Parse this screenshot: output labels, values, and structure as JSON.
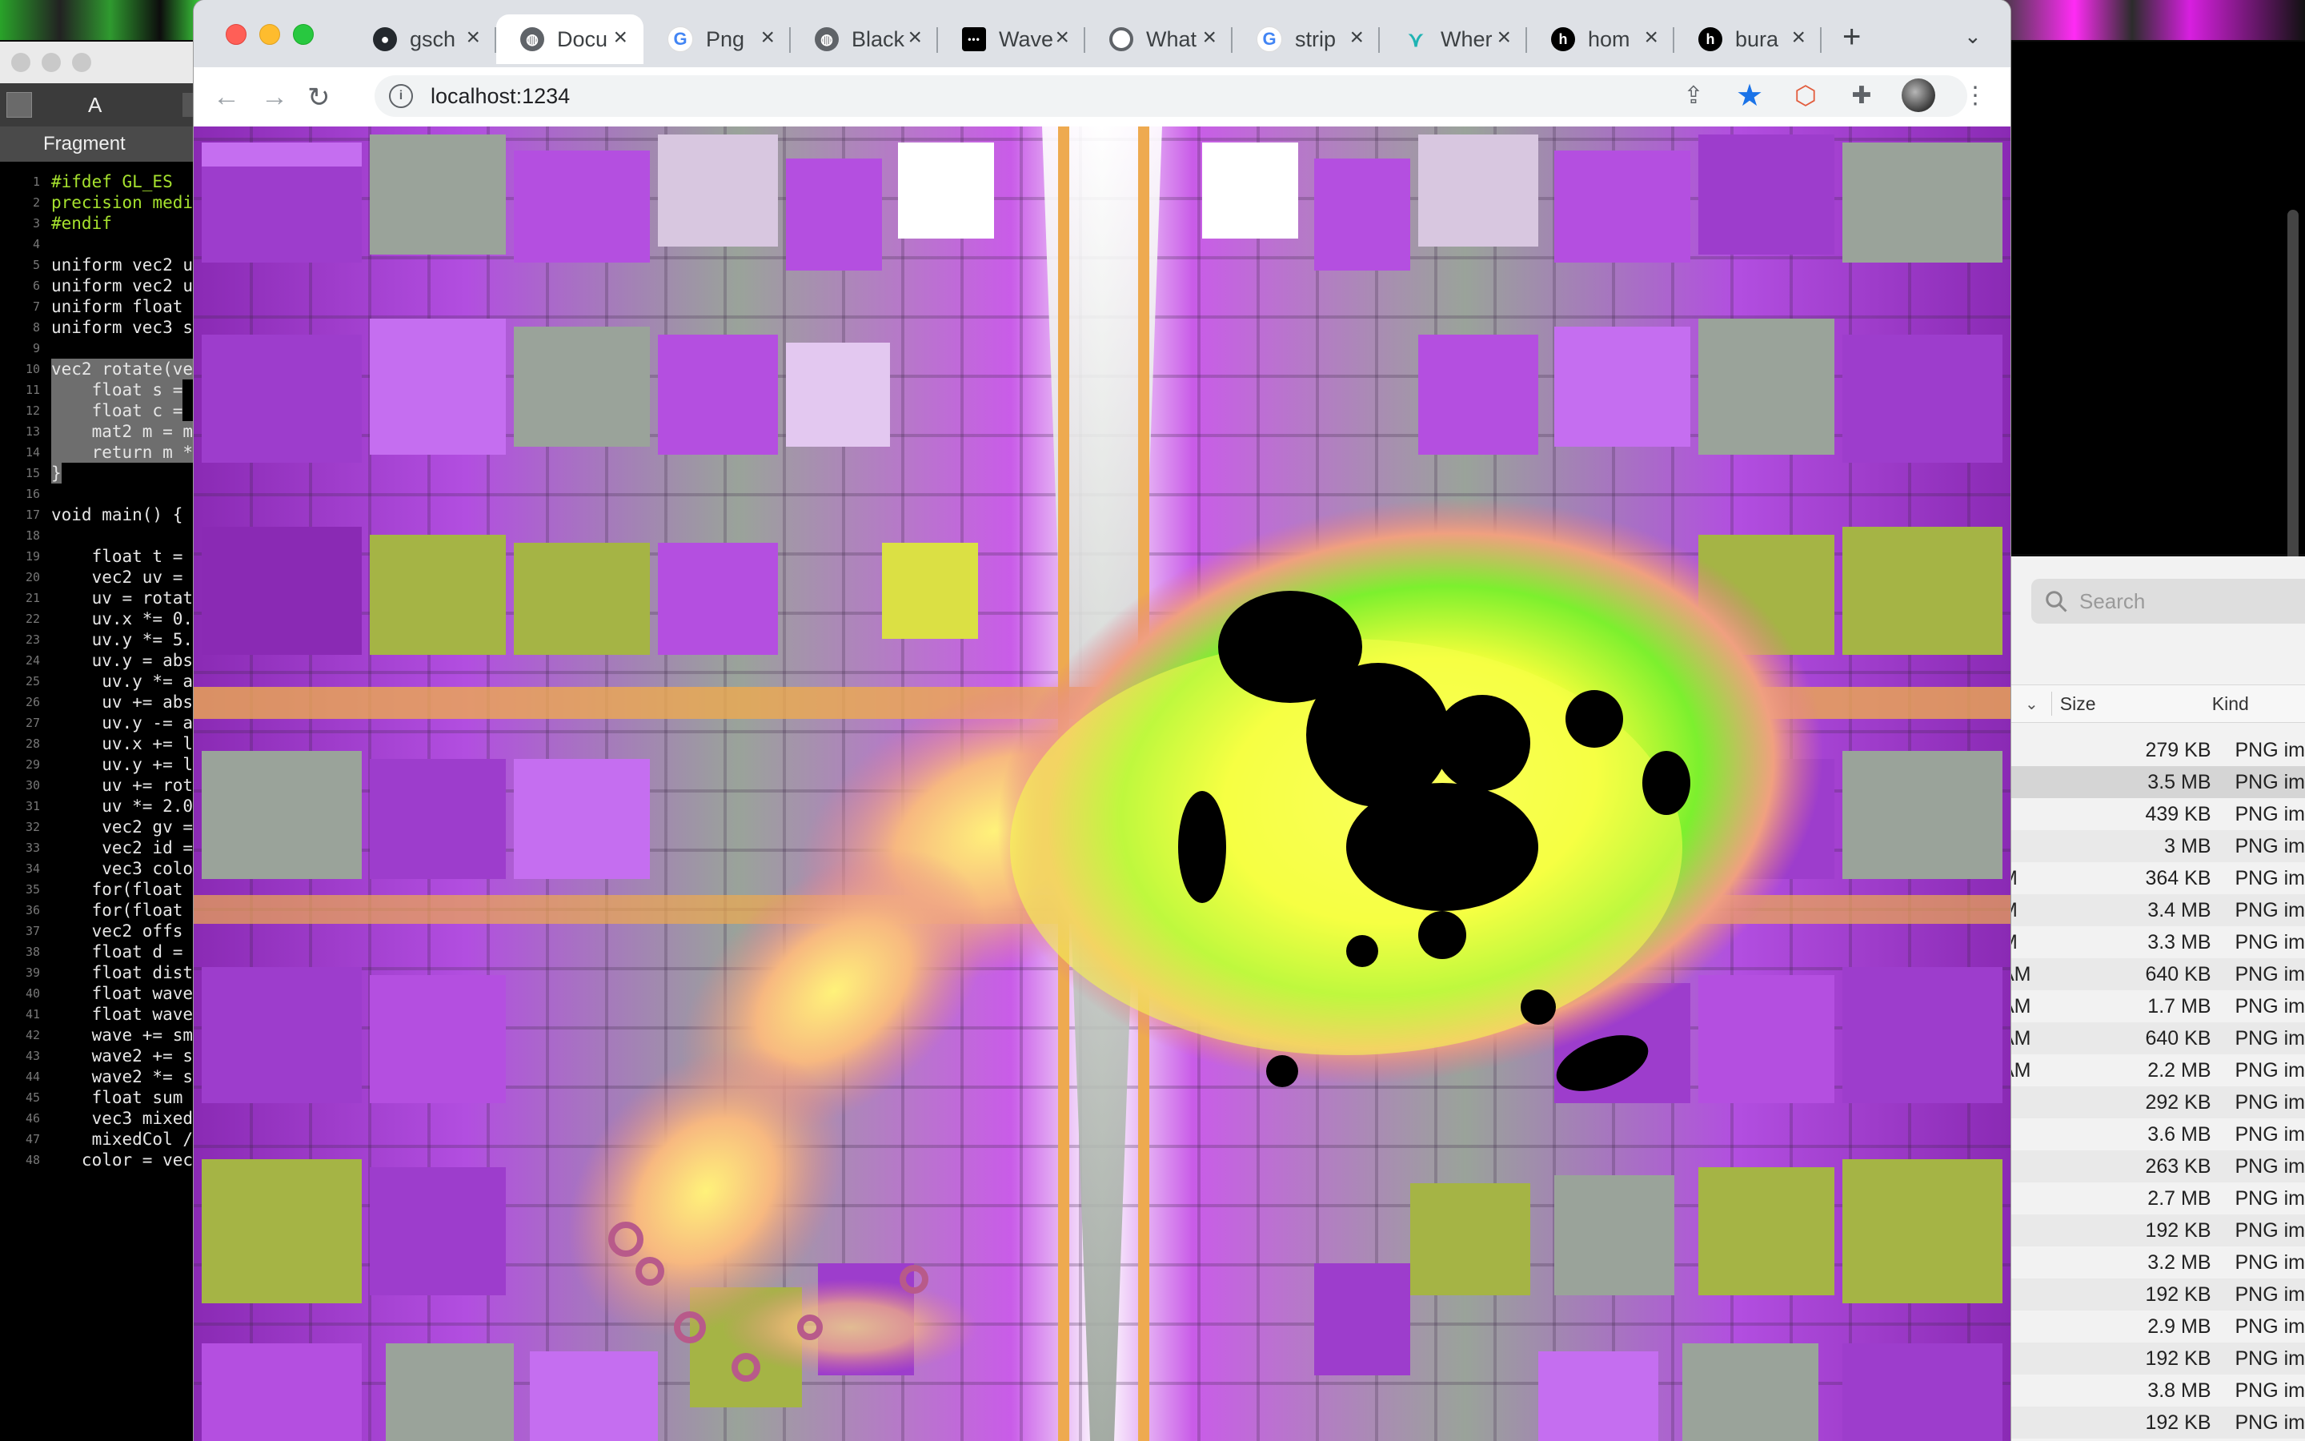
{
  "editor": {
    "toolbar_label": "A",
    "tab_label": "Fragment",
    "lines": [
      {
        "n": "1",
        "text": "#ifdef GL_ES",
        "kind": "pre"
      },
      {
        "n": "2",
        "text": "precision medi",
        "kind": "pre"
      },
      {
        "n": "3",
        "text": "#endif",
        "kind": "pre"
      },
      {
        "n": "4",
        "text": "",
        "kind": "code"
      },
      {
        "n": "5",
        "text": "uniform vec2 u",
        "kind": "code"
      },
      {
        "n": "6",
        "text": "uniform vec2 u",
        "kind": "code"
      },
      {
        "n": "7",
        "text": "uniform float",
        "kind": "code"
      },
      {
        "n": "8",
        "text": "uniform vec3 s",
        "kind": "code"
      },
      {
        "n": "9",
        "text": "",
        "kind": "code"
      },
      {
        "n": "10",
        "text": "vec2 rotate(ve",
        "kind": "sel"
      },
      {
        "n": "11",
        "text": "    float s =",
        "kind": "sel"
      },
      {
        "n": "12",
        "text": "    float c =",
        "kind": "sel"
      },
      {
        "n": "13",
        "text": "    mat2 m = m",
        "kind": "sel"
      },
      {
        "n": "14",
        "text": "    return m *",
        "kind": "sel"
      },
      {
        "n": "15",
        "text": "}",
        "kind": "sel"
      },
      {
        "n": "16",
        "text": "",
        "kind": "code"
      },
      {
        "n": "17",
        "text": "void main() {",
        "kind": "code"
      },
      {
        "n": "18",
        "text": "",
        "kind": "code"
      },
      {
        "n": "19",
        "text": "    float t =",
        "kind": "code"
      },
      {
        "n": "20",
        "text": "    vec2 uv =",
        "kind": "code"
      },
      {
        "n": "21",
        "text": "    uv = rotat",
        "kind": "code"
      },
      {
        "n": "22",
        "text": "    uv.x *= 0.",
        "kind": "code"
      },
      {
        "n": "23",
        "text": "    uv.y *= 5.",
        "kind": "code"
      },
      {
        "n": "24",
        "text": "    uv.y = abs",
        "kind": "code"
      },
      {
        "n": "25",
        "text": "     uv.y *= a",
        "kind": "code"
      },
      {
        "n": "26",
        "text": "     uv += abs",
        "kind": "code"
      },
      {
        "n": "27",
        "text": "     uv.y -= a",
        "kind": "code"
      },
      {
        "n": "28",
        "text": "     uv.x += l",
        "kind": "code"
      },
      {
        "n": "29",
        "text": "     uv.y += l",
        "kind": "code"
      },
      {
        "n": "30",
        "text": "     uv += rot",
        "kind": "code"
      },
      {
        "n": "31",
        "text": "     uv *= 2.0",
        "kind": "code"
      },
      {
        "n": "32",
        "text": "     vec2 gv =",
        "kind": "code"
      },
      {
        "n": "33",
        "text": "     vec2 id =",
        "kind": "code"
      },
      {
        "n": "34",
        "text": "     vec3 colo",
        "kind": "code"
      },
      {
        "n": "35",
        "text": "    for(float",
        "kind": "code"
      },
      {
        "n": "36",
        "text": "    for(float",
        "kind": "code"
      },
      {
        "n": "37",
        "text": "    vec2 offs",
        "kind": "code"
      },
      {
        "n": "38",
        "text": "    float d =",
        "kind": "code"
      },
      {
        "n": "39",
        "text": "    float dist",
        "kind": "code"
      },
      {
        "n": "40",
        "text": "    float wave",
        "kind": "code"
      },
      {
        "n": "41",
        "text": "    float wave",
        "kind": "code"
      },
      {
        "n": "42",
        "text": "    wave += sm",
        "kind": "code"
      },
      {
        "n": "43",
        "text": "    wave2 += s",
        "kind": "code"
      },
      {
        "n": "44",
        "text": "    wave2 *= s",
        "kind": "code"
      },
      {
        "n": "45",
        "text": "    float sum",
        "kind": "code"
      },
      {
        "n": "46",
        "text": "    vec3 mixed",
        "kind": "code"
      },
      {
        "n": "47",
        "text": "    mixedCol /",
        "kind": "code"
      },
      {
        "n": "48",
        "text": "   color = vec",
        "kind": "code"
      }
    ]
  },
  "browser": {
    "tabs": [
      {
        "title": "gsch",
        "favicon": "github-icon",
        "active": false
      },
      {
        "title": "Docu",
        "favicon": "globe-icon",
        "active": true
      },
      {
        "title": "Png",
        "favicon": "google-icon",
        "active": false
      },
      {
        "title": "Black",
        "favicon": "globe-icon",
        "active": false
      },
      {
        "title": "Wave",
        "favicon": "dots-icon",
        "active": false
      },
      {
        "title": "What",
        "favicon": "chromium-icon",
        "active": false
      },
      {
        "title": "strip",
        "favicon": "google-icon",
        "active": false
      },
      {
        "title": "Wher",
        "favicon": "bird-icon",
        "active": false
      },
      {
        "title": "hom",
        "favicon": "h-icon",
        "active": false
      },
      {
        "title": "bura",
        "favicon": "h-icon",
        "active": false
      }
    ],
    "url": "localhost:1234"
  },
  "finder": {
    "search_placeholder": "Search",
    "col_size": "Size",
    "col_kind": "Kind",
    "rows": [
      {
        "date": "",
        "size": "279 KB",
        "kind": "PNG im"
      },
      {
        "date": "",
        "size": "3.5 MB",
        "kind": "PNG im"
      },
      {
        "date": "",
        "size": "439 KB",
        "kind": "PNG im"
      },
      {
        "date": "",
        "size": "3 MB",
        "kind": "PNG im"
      },
      {
        "date": "M",
        "size": "364 KB",
        "kind": "PNG im"
      },
      {
        "date": "M",
        "size": "3.4 MB",
        "kind": "PNG im"
      },
      {
        "date": "M",
        "size": "3.3 MB",
        "kind": "PNG im"
      },
      {
        "date": "AM",
        "size": "640 KB",
        "kind": "PNG im"
      },
      {
        "date": "AM",
        "size": "1.7 MB",
        "kind": "PNG im"
      },
      {
        "date": "AM",
        "size": "640 KB",
        "kind": "PNG im"
      },
      {
        "date": "AM",
        "size": "2.2 MB",
        "kind": "PNG im"
      },
      {
        "date": "",
        "size": "292 KB",
        "kind": "PNG im"
      },
      {
        "date": "",
        "size": "3.6 MB",
        "kind": "PNG im"
      },
      {
        "date": "",
        "size": "263 KB",
        "kind": "PNG im"
      },
      {
        "date": "",
        "size": "2.7 MB",
        "kind": "PNG im"
      },
      {
        "date": "",
        "size": "192 KB",
        "kind": "PNG im"
      },
      {
        "date": "",
        "size": "3.2 MB",
        "kind": "PNG im"
      },
      {
        "date": "",
        "size": "192 KB",
        "kind": "PNG im"
      },
      {
        "date": "",
        "size": "2.9 MB",
        "kind": "PNG im"
      },
      {
        "date": "",
        "size": "192 KB",
        "kind": "PNG im"
      },
      {
        "date": "",
        "size": "3.8 MB",
        "kind": "PNG im"
      },
      {
        "date": "",
        "size": "192 KB",
        "kind": "PNG im"
      }
    ]
  }
}
